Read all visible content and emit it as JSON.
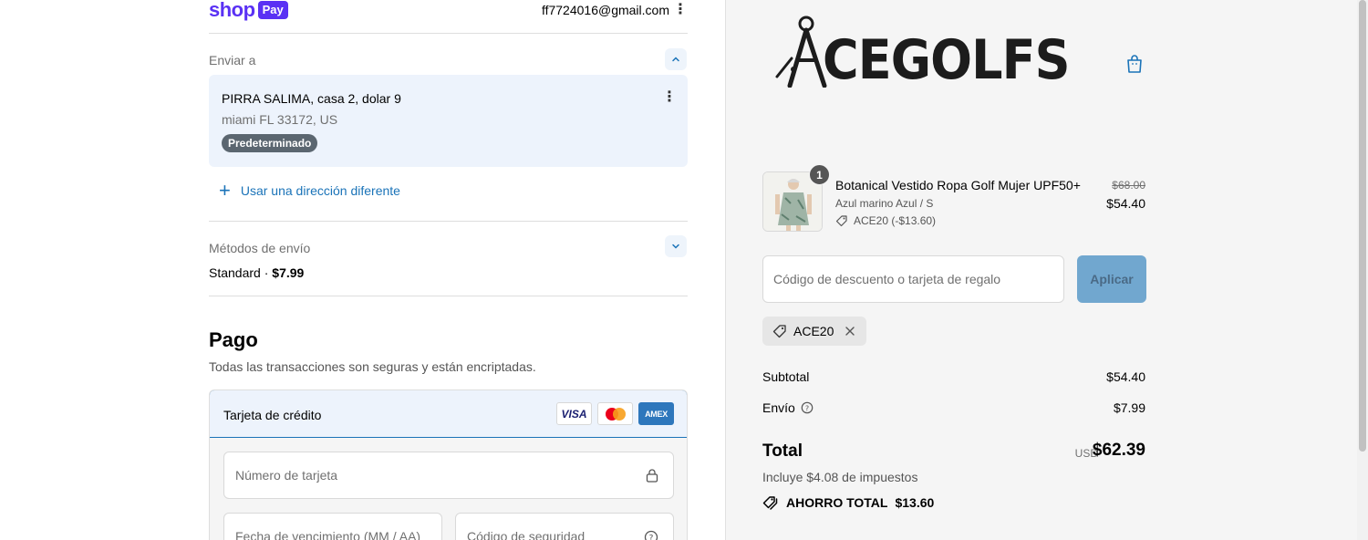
{
  "header": {
    "shop_word": "shop",
    "pay_badge": "Pay",
    "email": "ff7724016@gmail.com"
  },
  "shipping_address": {
    "section_label": "Enviar a",
    "line1": "PIRRA SALIMA, casa 2, dolar 9",
    "line2": "miami FL 33172, US",
    "default_badge": "Predeterminado",
    "use_different_label": "Usar una dirección diferente"
  },
  "shipping_methods": {
    "section_label": "Métodos de envío",
    "method_name": "Standard",
    "separator": " · ",
    "method_price": "$7.99"
  },
  "payment": {
    "title": "Pago",
    "subtitle": "Todas las transacciones son seguras y están encriptadas.",
    "credit_card_label": "Tarjeta de crédito",
    "brands": {
      "visa": "VISA",
      "amex": "AMEX"
    },
    "card_number_placeholder": "Número de tarjeta",
    "expiry_placeholder": "Fecha de vencimiento (MM / AA)",
    "security_code_placeholder": "Código de seguridad"
  },
  "brand_logo": {
    "text": "CEGOLFS"
  },
  "order": {
    "product": {
      "quantity": "1",
      "name": "Botanical Vestido Ropa Golf Mujer UPF50+",
      "variant": "Azul marino Azul / S",
      "discount": "ACE20 (-$13.60)",
      "original_price": "$68.00",
      "price": "$54.40"
    },
    "discount_placeholder": "Código de descuento o tarjeta de regalo",
    "apply_label": "Aplicar",
    "applied_code": "ACE20",
    "subtotal_label": "Subtotal",
    "subtotal_value": "$54.40",
    "shipping_label": "Envío",
    "shipping_value": "$7.99",
    "total_label": "Total",
    "currency": "USD",
    "total_value": "$62.39",
    "tax_note": "Incluye $4.08 de impuestos",
    "savings_label": "AHORRO TOTAL",
    "savings_value": "$13.60"
  },
  "colors": {
    "shop_purple": "#5a31f4",
    "link_blue": "#1a73b8",
    "apply_button": "#71a7cf"
  }
}
